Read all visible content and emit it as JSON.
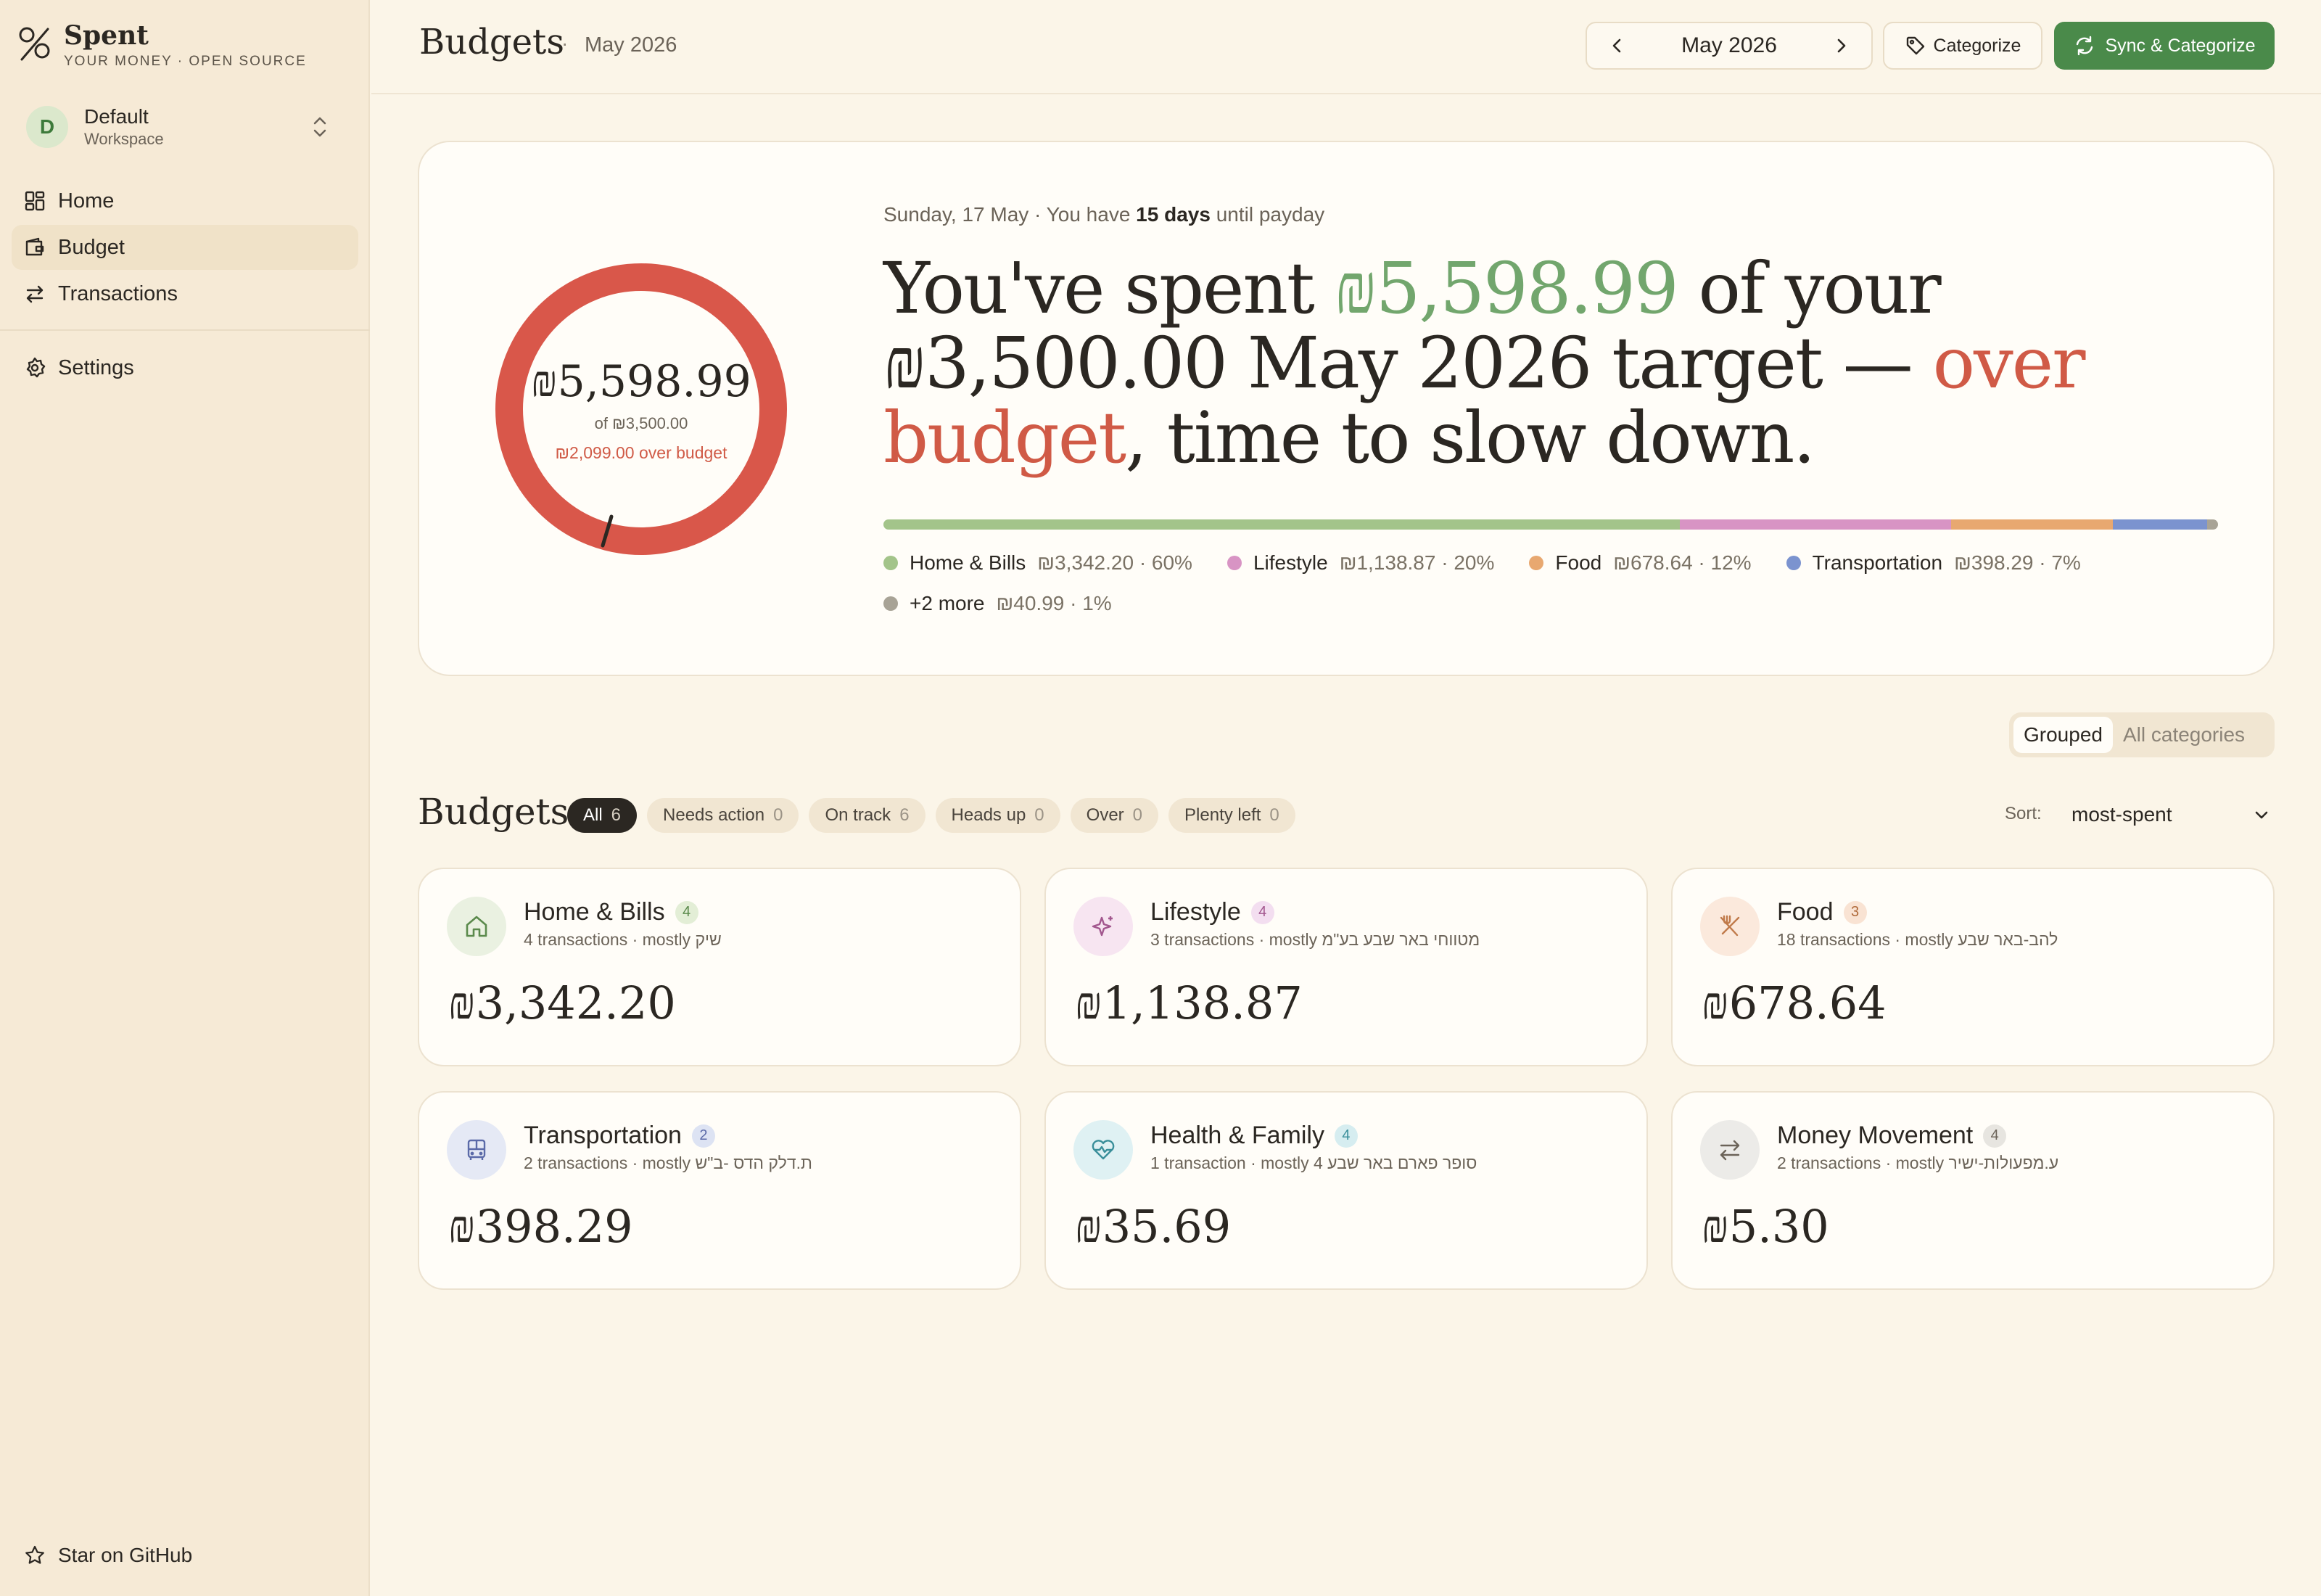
{
  "app": {
    "name": "Spent",
    "tagline": "YOUR MONEY · OPEN SOURCE"
  },
  "workspace": {
    "initial": "D",
    "name": "Default",
    "subtitle": "Workspace"
  },
  "nav": {
    "items": [
      {
        "label": "Home",
        "icon": "grid-icon"
      },
      {
        "label": "Budget",
        "icon": "wallet-icon",
        "active": true
      },
      {
        "label": "Transactions",
        "icon": "arrows-icon"
      }
    ],
    "settings": "Settings",
    "github": "Star on GitHub"
  },
  "header": {
    "title": "Budgets",
    "separator": "·",
    "period": "May 2026",
    "month_label": "May 2026",
    "categorize": "Categorize",
    "sync": "Sync & Categorize"
  },
  "hero": {
    "date_prefix": "Sunday, 17 May · You have ",
    "days": "15 days",
    "date_suffix": " until payday",
    "donut_amount": "₪5,598.99",
    "donut_of": "of ₪3,500.00",
    "donut_over": "₪2,099.00 over budget",
    "donut_progress": 1.6,
    "hl_1": "You've spent ",
    "hl_spent": "₪5,598.99",
    "hl_2": " of your ₪3,500.00 May 2026 target — ",
    "hl_over": "over budget",
    "hl_3": ", time to slow down.",
    "colors": {
      "spent": "#72a66d",
      "over": "#d05a46",
      "ring": "#d9574a"
    },
    "breakdown": [
      {
        "name": "Home & Bills",
        "value": "₪3,342.20 · 60%",
        "share": 0.597,
        "color": "#a3c48a"
      },
      {
        "name": "Lifestyle",
        "value": "₪1,138.87 · 20%",
        "share": 0.203,
        "color": "#d894c4"
      },
      {
        "name": "Food",
        "value": "₪678.64 · 12%",
        "share": 0.121,
        "color": "#e8a870"
      },
      {
        "name": "Transportation",
        "value": "₪398.29 · 7%",
        "share": 0.071,
        "color": "#7b93cf"
      },
      {
        "name": "+2 more",
        "value": "₪40.99 · 1%",
        "share": 0.008,
        "color": "#a8a396"
      }
    ]
  },
  "view_toggle": {
    "grouped": "Grouped",
    "all": "All categories"
  },
  "budgets": {
    "title": "Budgets",
    "filters": [
      {
        "label": "All",
        "count": "6",
        "active": true
      },
      {
        "label": "Needs action",
        "count": "0"
      },
      {
        "label": "On track",
        "count": "6"
      },
      {
        "label": "Heads up",
        "count": "0"
      },
      {
        "label": "Over",
        "count": "0"
      },
      {
        "label": "Plenty left",
        "count": "0"
      }
    ],
    "sort_label": "Sort:",
    "sort_value": "most-spent",
    "cards": [
      {
        "name": "Home & Bills",
        "count": "4",
        "sub": "4 transactions · mostly שיק",
        "amount": "₪3,342.20",
        "icon": "home-icon",
        "icon_bg": "#eaf1e1",
        "icon_color": "#5b8a4c",
        "badge_bg": "#e3eed6",
        "badge_color": "#5b8a4c"
      },
      {
        "name": "Lifestyle",
        "count": "4",
        "sub": "3 transactions · mostly מטווחי באר שבע בע\"מ",
        "amount": "₪1,138.87",
        "icon": "sparkle-icon",
        "icon_bg": "#f7e5f1",
        "icon_color": "#a2578e",
        "badge_bg": "#f3def0",
        "badge_color": "#a2578e"
      },
      {
        "name": "Food",
        "count": "3",
        "sub": "18 transactions · mostly להב-באר שבע",
        "amount": "₪678.64",
        "icon": "utensils-icon",
        "icon_bg": "#fbe9dc",
        "icon_color": "#c07a4a",
        "badge_bg": "#f9e3d3",
        "badge_color": "#b06a3a"
      },
      {
        "name": "Transportation",
        "count": "2",
        "sub": "2 transactions · mostly ת.דלק הדס -ב\"ש",
        "amount": "₪398.29",
        "icon": "bus-icon",
        "icon_bg": "#e5e9f5",
        "icon_color": "#5b6aa8",
        "badge_bg": "#dde3f3",
        "badge_color": "#5b6aa8"
      },
      {
        "name": "Health & Family",
        "count": "4",
        "sub": "1 transaction · mostly סופר פארם באר שבע 4",
        "amount": "₪35.69",
        "icon": "heart-pulse-icon",
        "icon_bg": "#dff1f3",
        "icon_color": "#3a8f9a",
        "badge_bg": "#d6edf0",
        "badge_color": "#3a8f9a"
      },
      {
        "name": "Money Movement",
        "count": "4",
        "sub": "2 transactions · mostly ע.מפעולות-ישיר",
        "amount": "₪5.30",
        "icon": "swap-icon",
        "icon_bg": "#ecebe8",
        "icon_color": "#6b6358",
        "badge_bg": "#e7e5e0",
        "badge_color": "#6b6358"
      }
    ]
  }
}
